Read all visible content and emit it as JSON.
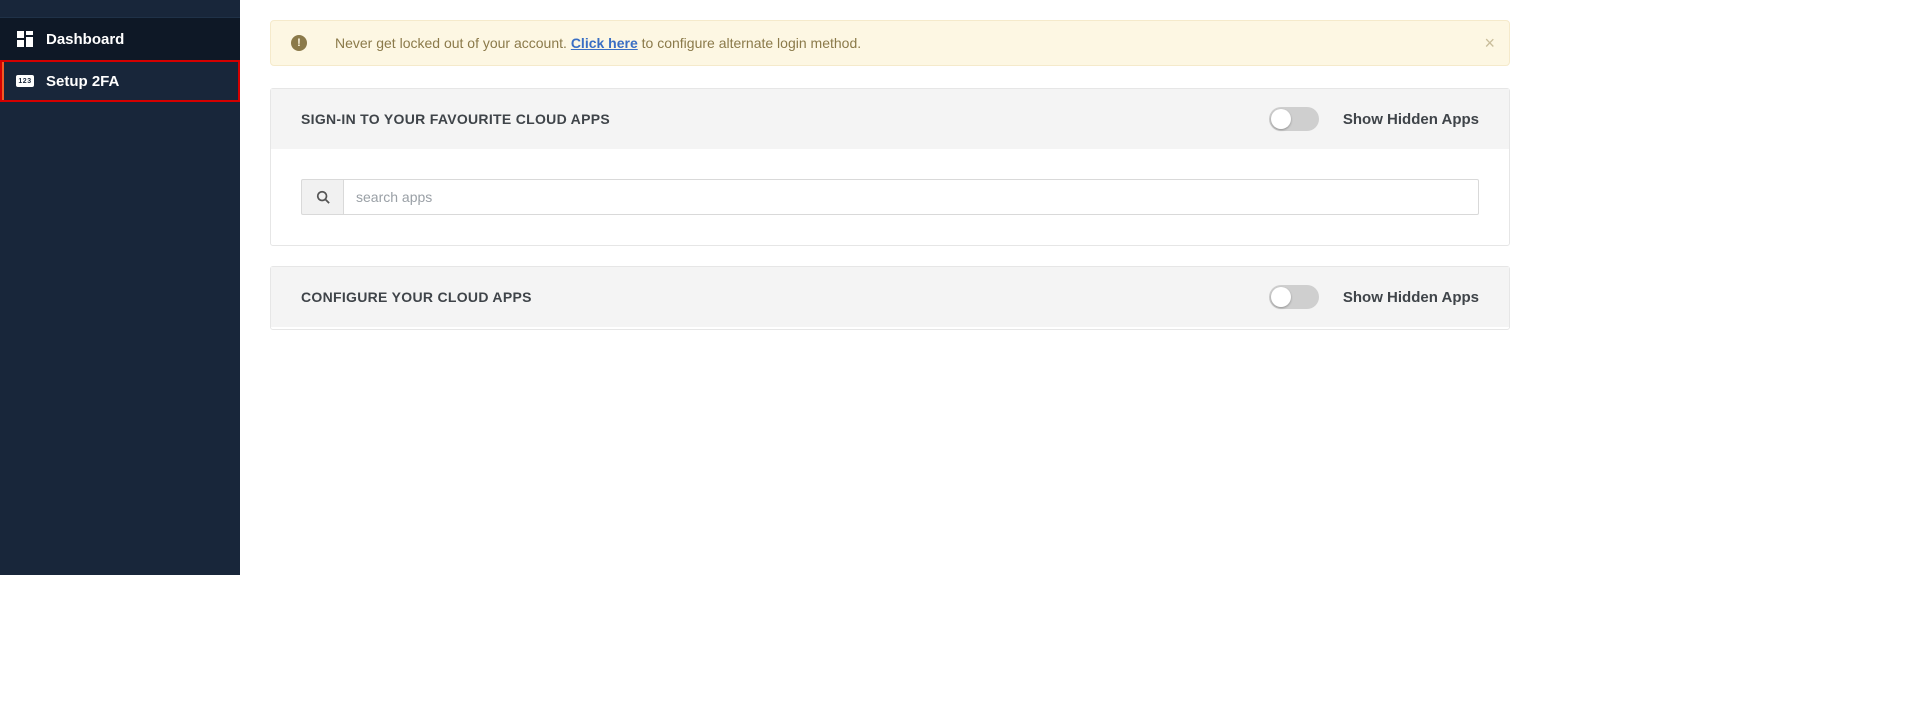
{
  "sidebar": {
    "items": [
      {
        "label": "Dashboard",
        "icon": "dashboard-icon"
      },
      {
        "label": "Setup 2FA",
        "icon": "otp-badge-icon",
        "badge_text": "123"
      }
    ]
  },
  "alert": {
    "text_before_link": "Never get locked out of your account. ",
    "link_text": "Click here",
    "text_after_link": " to configure alternate login method."
  },
  "panels": {
    "signin": {
      "title": "SIGN-IN TO YOUR FAVOURITE CLOUD APPS",
      "toggle_label": "Show Hidden Apps",
      "search_placeholder": "search apps"
    },
    "configure": {
      "title": "CONFIGURE YOUR CLOUD APPS",
      "toggle_label": "Show Hidden Apps"
    }
  }
}
